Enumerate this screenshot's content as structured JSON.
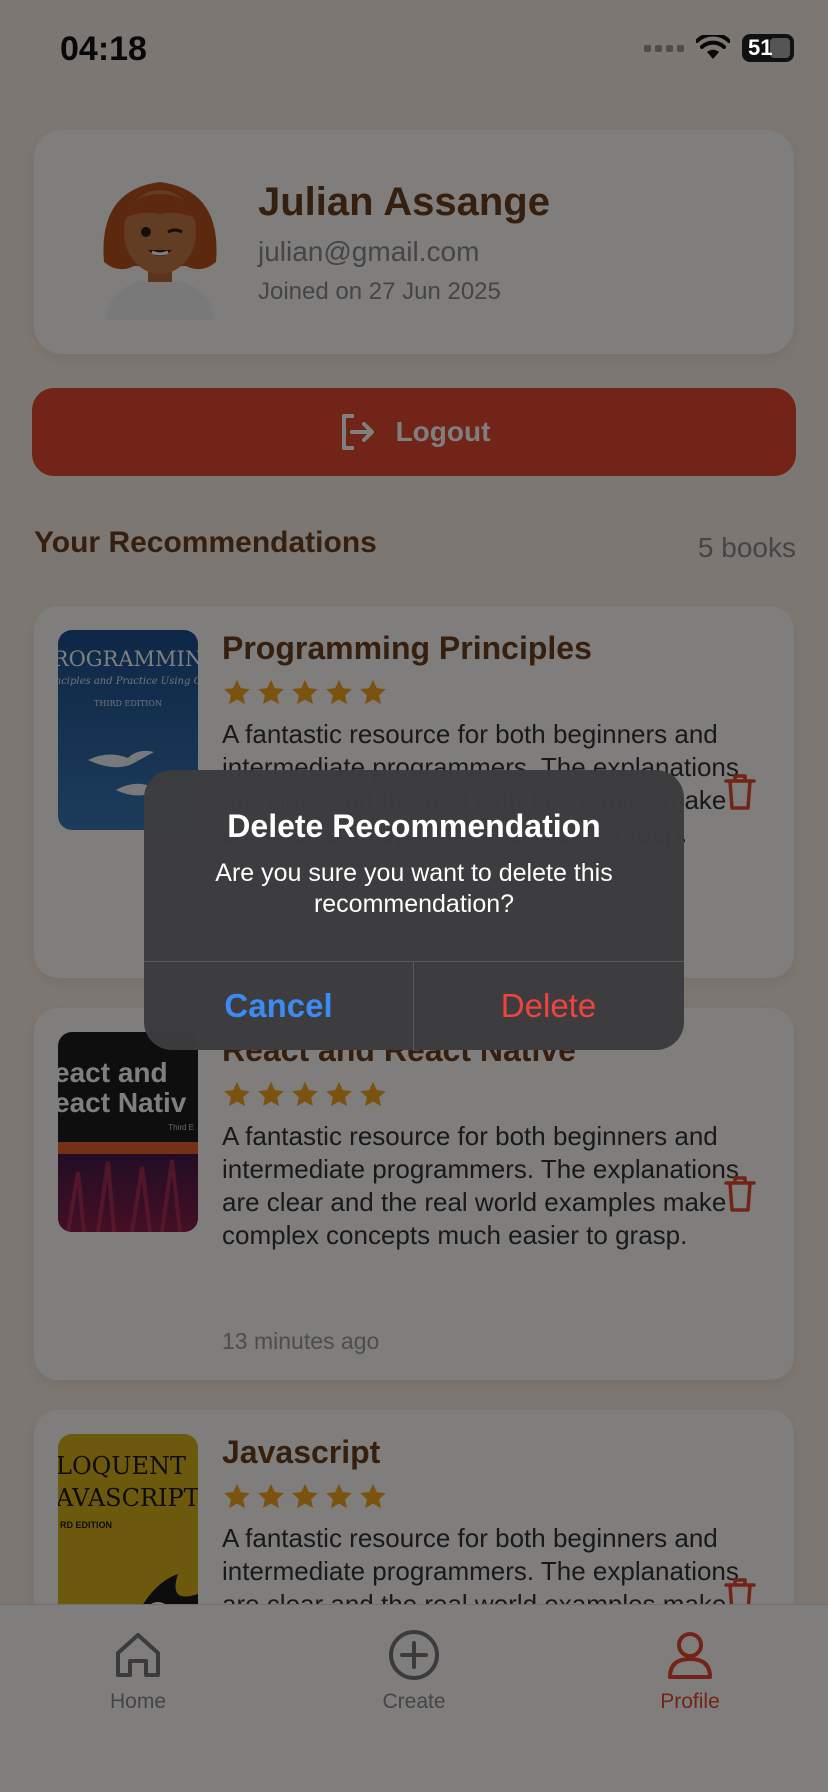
{
  "status_bar": {
    "time": "04:18",
    "battery": "51"
  },
  "profile": {
    "name": "Julian Assange",
    "email": "julian@gmail.com",
    "joined": "Joined on 27 Jun 2025"
  },
  "logout": {
    "label": "Logout"
  },
  "recommendations": {
    "title": "Your Recommendations",
    "count": "5 books",
    "items": [
      {
        "title": "Programming Principles",
        "rating": 5,
        "description": "A fantastic resource for both beginners and intermediate programmers. The explanations are clear and the real world examples make complex concepts much easier to grasp.",
        "time": "",
        "cover_lines": [
          "ROGRAMMIN",
          "nciples and Practice Using C",
          "THIRD EDITION"
        ]
      },
      {
        "title": "React and React Native",
        "rating": 5,
        "description": "A fantastic resource for both beginners and intermediate programmers. The explanations are clear and the real world examples make complex concepts much easier to grasp.",
        "time": "13 minutes ago",
        "cover_lines": [
          "eact and",
          "eact Nativ",
          "Third E"
        ]
      },
      {
        "title": "Javascript",
        "rating": 5,
        "description": "A fantastic resource for both beginners and intermediate programmers. The explanations are clear and the real world examples make complex concepts much easier to grasp.",
        "time": "",
        "cover_lines": [
          "LOQUENT",
          "AVASCRIPT",
          "RD EDITION"
        ]
      }
    ]
  },
  "bottom_nav": {
    "items": [
      {
        "label": "Home",
        "icon": "home-icon",
        "active": false
      },
      {
        "label": "Create",
        "icon": "plus-circle-icon",
        "active": false
      },
      {
        "label": "Profile",
        "icon": "user-icon",
        "active": true
      }
    ]
  },
  "alert": {
    "title": "Delete Recommendation",
    "message": "Are you sure you want to delete this recommendation?",
    "cancel_label": "Cancel",
    "delete_label": "Delete"
  },
  "colors": {
    "accent": "#E3482E",
    "brown": "#6B3E1E",
    "star": "#F5A623",
    "cancel": "#3B8BF2",
    "delete": "#F0433D"
  }
}
